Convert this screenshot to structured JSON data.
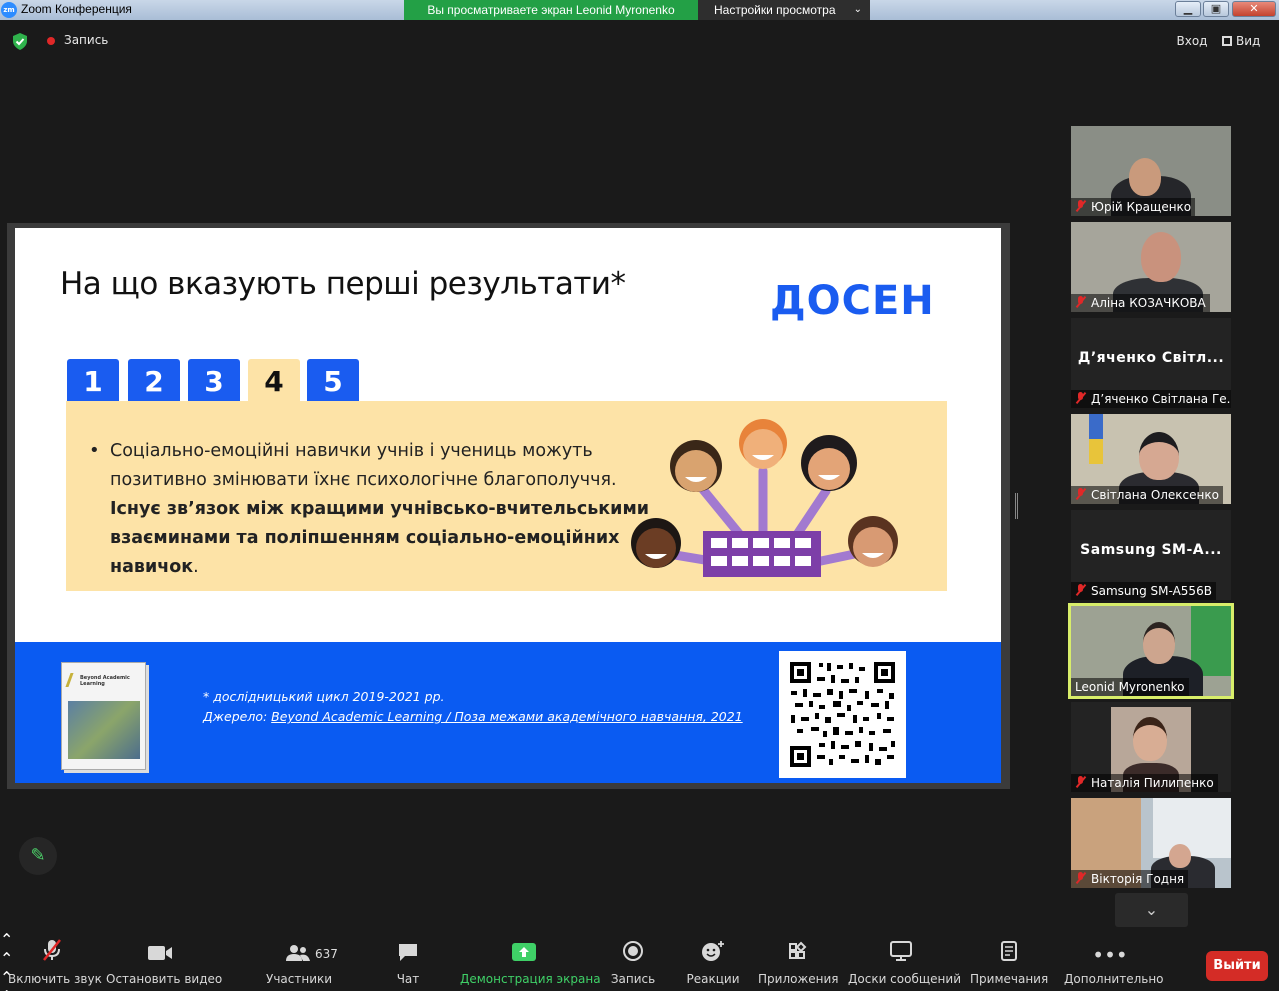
{
  "window": {
    "title": "Zoom Конференция",
    "logo_text": "zm"
  },
  "share_banner": {
    "viewing_text": "Вы просматриваете экран Leonid Myronenko",
    "settings_label": "Настройки просмотра"
  },
  "topbar": {
    "recording_label": "Запись",
    "enter_label": "Вход",
    "view_label": "Вид"
  },
  "slide": {
    "title": "На що вказують перші результати*",
    "brand": "ДОСЕН",
    "tabs": [
      "1",
      "2",
      "3",
      "4",
      "5"
    ],
    "active_tab": "4",
    "bullet_normal": "Соціально-емоційні навички учнів і учениць можуть позитивно змінювати їхнє психологічне благополуччя.",
    "bullet_bold": "Існує зв’язок між кращими учнівсько-вчительськими взаєминами та поліпшенням соціально-емоційних навичок",
    "bullet_end": ".",
    "footnote_1": "* дослідницький цикл 2019-2021 рр.",
    "footnote_2_prefix": "Джерело: ",
    "footnote_2_link": "Beyond Academic Learning / Поза межами академічного навчання, 2021",
    "book_title": "Beyond Academic Learning"
  },
  "participants": [
    {
      "name": "Юрій Кращенко",
      "video": true,
      "muted": true
    },
    {
      "name": "Аліна КОЗАЧКОВА",
      "video": true,
      "muted": true
    },
    {
      "name": "Д’яченко Світлана Ге...",
      "display": "Д’яченко Світл...",
      "video": false,
      "muted": true
    },
    {
      "name": "Світлана Олексенко",
      "video": true,
      "muted": true
    },
    {
      "name": "Samsung SM-A556B",
      "display": "Samsung SM-A...",
      "video": false,
      "muted": true
    },
    {
      "name": "Leonid Myronenko",
      "video": true,
      "muted": false,
      "active_speaker": true
    },
    {
      "name": "Наталія Пилипенко",
      "video": true,
      "muted": true
    },
    {
      "name": "Вікторія Годня",
      "video": true,
      "muted": true
    }
  ],
  "toolbar": {
    "unmute": "Включить звук",
    "stop_video": "Остановить видео",
    "participants": "Участники",
    "participants_count": "637",
    "chat": "Чат",
    "share": "Демонстрация экрана",
    "record": "Запись",
    "reactions": "Реакции",
    "apps": "Приложения",
    "whiteboards": "Доски сообщений",
    "notes": "Примечания",
    "more": "Дополнительно",
    "leave": "Выйти"
  },
  "colors": {
    "share_green": "#23a046",
    "brand_blue": "#0a5bf2",
    "panel_yellow": "#fde3a7",
    "leave_red": "#d42c26",
    "active_border": "#d8ee6a"
  }
}
